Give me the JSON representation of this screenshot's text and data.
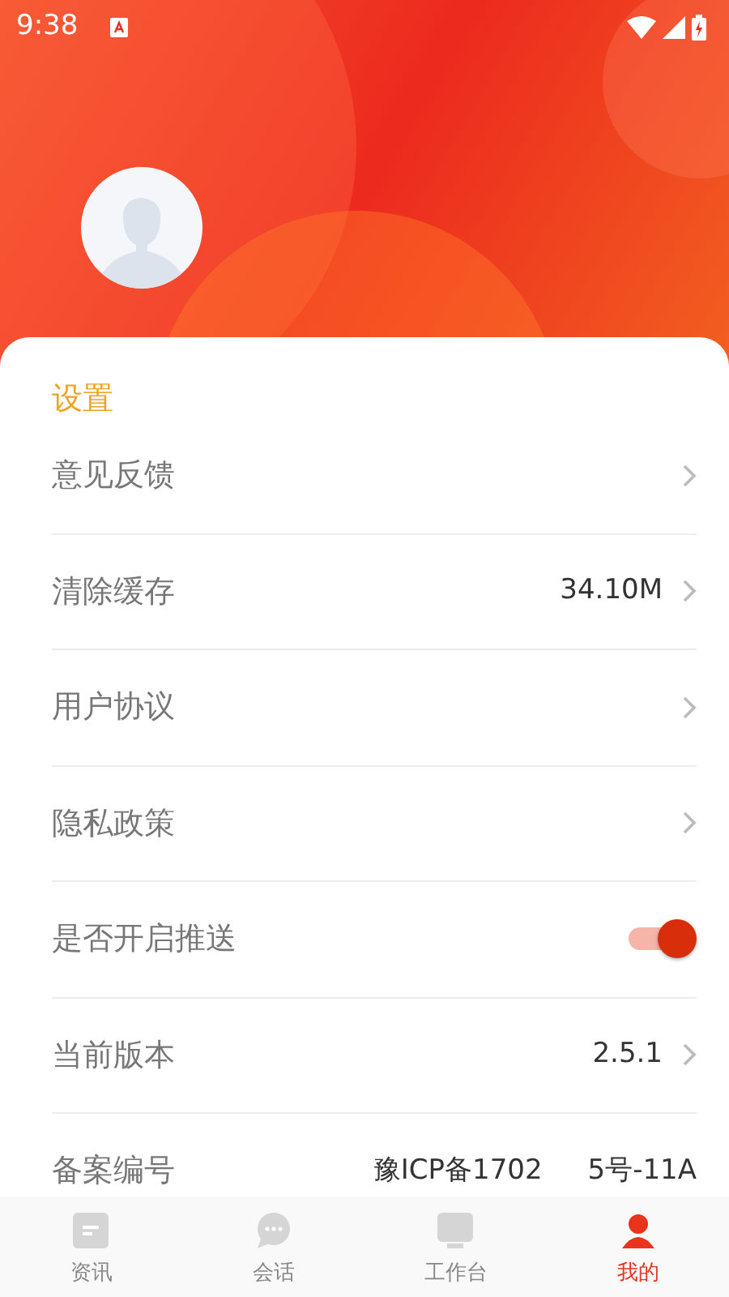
{
  "status_bar": {
    "time": "9:38"
  },
  "section_title": "设置",
  "settings": [
    {
      "kind": "link",
      "label": "意见反馈"
    },
    {
      "kind": "link",
      "label": "清除缓存",
      "value": "34.10M"
    },
    {
      "kind": "link",
      "label": "用户协议"
    },
    {
      "kind": "link",
      "label": "隐私政策"
    },
    {
      "kind": "toggle",
      "label": "是否开启推送",
      "on": true
    },
    {
      "kind": "link",
      "label": "当前版本",
      "value": "2.5.1"
    },
    {
      "kind": "text",
      "label": "备案编号",
      "value_parts": [
        "豫ICP备1702",
        "5号-11A"
      ]
    }
  ],
  "tab_bar": [
    {
      "kind": "doc",
      "label": "资讯",
      "selected": false
    },
    {
      "kind": "chat",
      "label": "会话",
      "selected": false
    },
    {
      "kind": "desk",
      "label": "工作台",
      "selected": false
    },
    {
      "kind": "person",
      "label": "我的",
      "selected": true
    }
  ]
}
